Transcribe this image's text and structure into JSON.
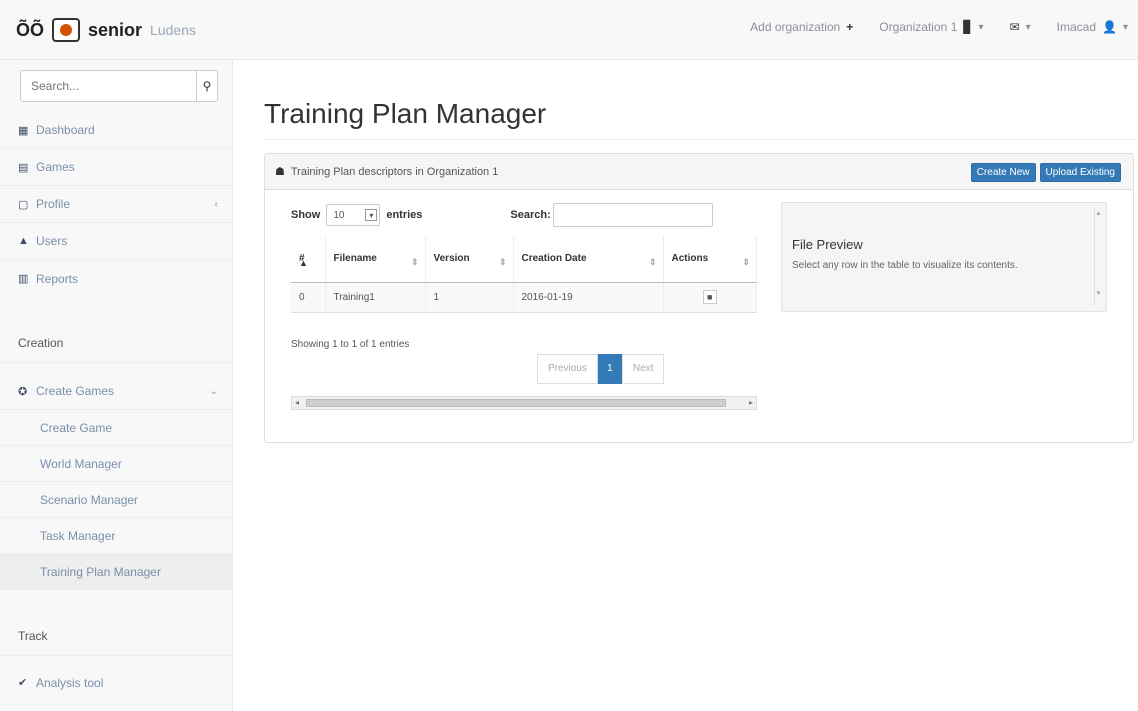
{
  "navbar": {
    "brand_name": "senior",
    "brand_sub": "Ludens",
    "links": [
      {
        "label": "Add organization",
        "icon": "plus-icon"
      },
      {
        "label": "Organization 1",
        "icon": "building-icon"
      },
      {
        "label": "",
        "icon": "envelope-icon"
      },
      {
        "label": "Imacad",
        "icon": "user-icon"
      }
    ]
  },
  "sidebar": {
    "search_placeholder": "Search...",
    "items": [
      {
        "label": "Dashboard",
        "icon": "dashboard-icon"
      },
      {
        "label": "Games",
        "icon": "games-icon"
      },
      {
        "label": "Profile",
        "icon": "profile-icon"
      },
      {
        "label": "Users",
        "icon": "users-icon"
      },
      {
        "label": "Reports",
        "icon": "reports-icon"
      }
    ],
    "creation_heading": "Creation",
    "create_games_label": "Create Games",
    "sub_items": [
      {
        "label": "Create Game"
      },
      {
        "label": "World Manager"
      },
      {
        "label": "Scenario Manager"
      },
      {
        "label": "Task Manager"
      },
      {
        "label": "Training Plan Manager"
      }
    ],
    "track_heading": "Track",
    "analysis_label": "Analysis tool"
  },
  "main": {
    "title": "Training Plan Manager",
    "panel_title": "Training Plan descriptors in Organization 1",
    "btn_create": "Create New",
    "btn_upload": "Upload Existing",
    "show_label": "Show",
    "entries_value": "10",
    "entries_label": "entries",
    "search_label": "Search:",
    "table": {
      "headers": [
        "#",
        "Filename",
        "Version",
        "Creation Date",
        "Actions"
      ],
      "rows": [
        {
          "num": "0",
          "filename": "Training1",
          "version": "1",
          "date": "2016-01-19"
        }
      ]
    },
    "info": "Showing 1 to 1 of 1 entries",
    "pagination": {
      "prev": "Previous",
      "current": "1",
      "next": "Next"
    },
    "preview_title": "File Preview",
    "preview_text": "Select any row in the table to visualize its contents."
  }
}
